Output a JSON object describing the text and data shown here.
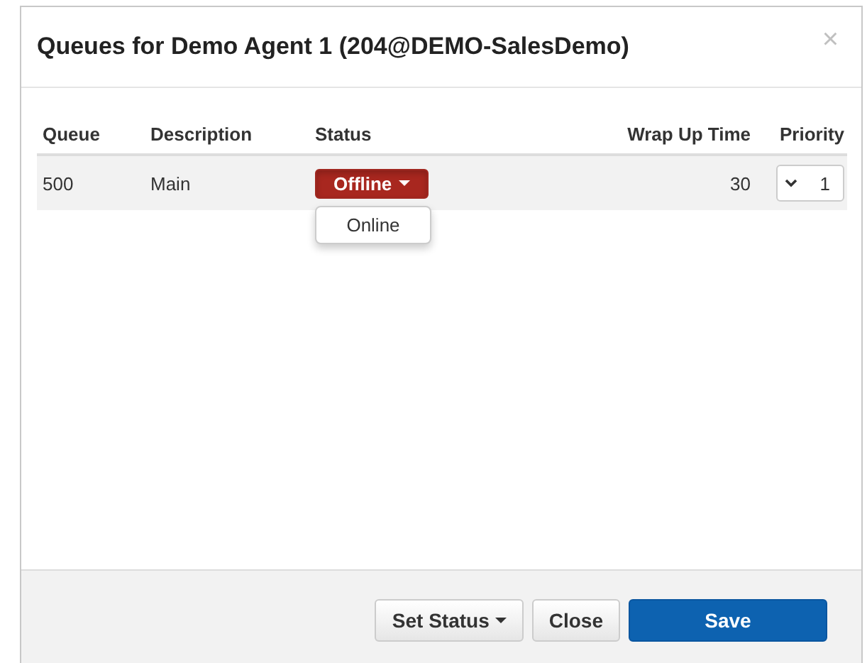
{
  "dialog": {
    "title": "Queues for Demo Agent 1 (204@DEMO-SalesDemo)",
    "close": "×"
  },
  "table": {
    "columns": [
      "Queue",
      "Description",
      "Status",
      "Wrap Up Time",
      "Priority"
    ],
    "rows": [
      {
        "queue": "500",
        "description": "Main",
        "status": "Offline",
        "status_menu": {
          "expanded": true,
          "options": [
            "Online"
          ]
        },
        "wrap_up_time": "30",
        "priority": "1"
      }
    ]
  },
  "footer": {
    "buttons": [
      {
        "label": "Set Status",
        "kind": "dropdown"
      },
      {
        "label": "Close",
        "kind": "default"
      },
      {
        "label": "Save",
        "kind": "primary"
      }
    ]
  }
}
